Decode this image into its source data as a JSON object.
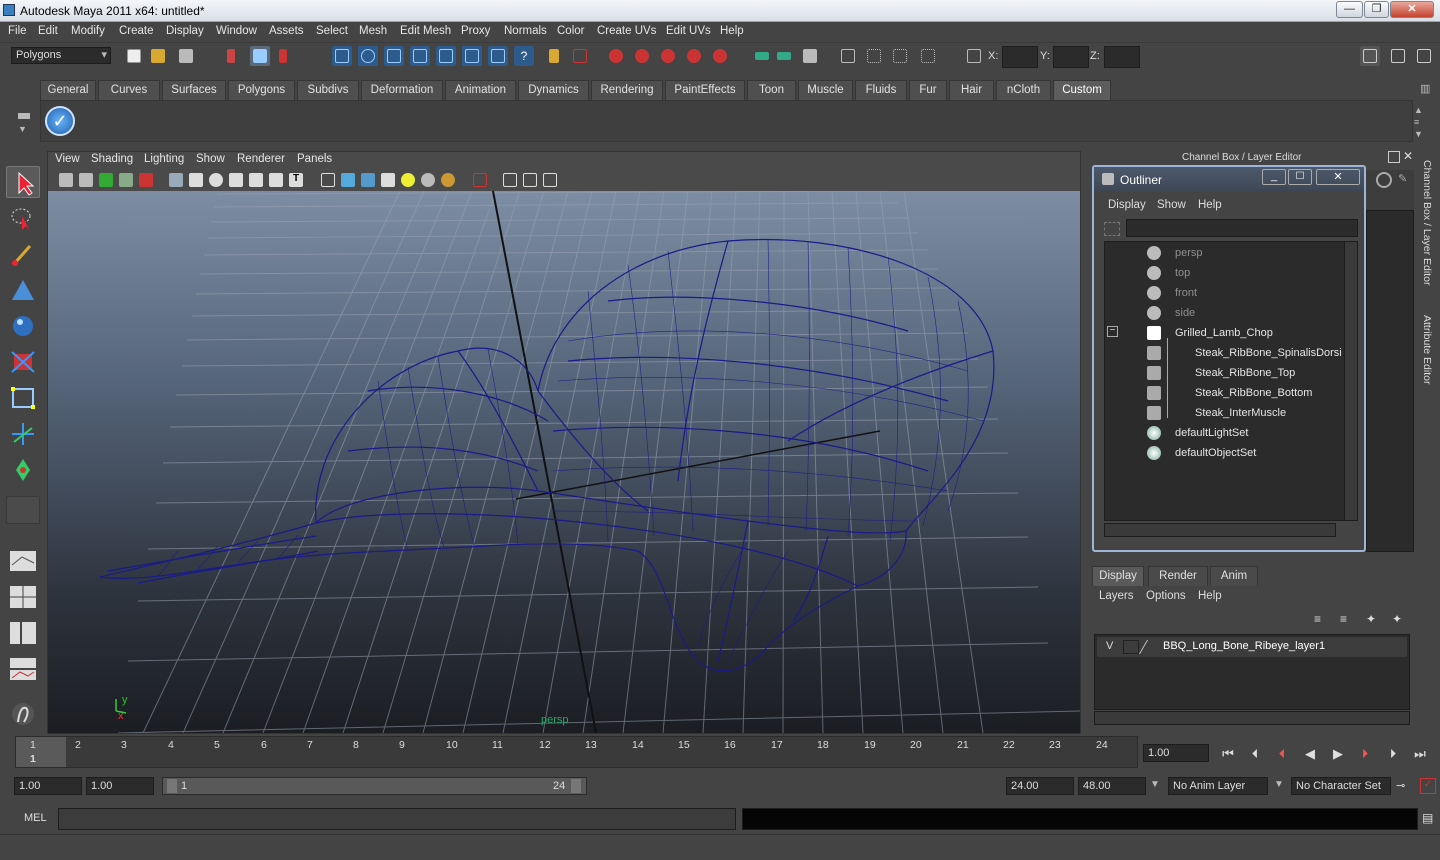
{
  "window": {
    "title": "Autodesk Maya 2011 x64: untitled*",
    "buttons": [
      "—",
      "❐",
      "✕"
    ]
  },
  "menubar": [
    "File",
    "Edit",
    "Modify",
    "Create",
    "Display",
    "Window",
    "Assets",
    "Select",
    "Mesh",
    "Edit Mesh",
    "Proxy",
    "Normals",
    "Color",
    "Create UVs",
    "Edit UVs",
    "Help"
  ],
  "status_line": {
    "mode": "Polygons",
    "x_label": "X:",
    "y_label": "Y:",
    "z_label": "Z:"
  },
  "shelf_tabs": [
    "General",
    "Curves",
    "Surfaces",
    "Polygons",
    "Subdivs",
    "Deformation",
    "Animation",
    "Dynamics",
    "Rendering",
    "PaintEffects",
    "Toon",
    "Muscle",
    "Fluids",
    "Fur",
    "Hair",
    "nCloth",
    "Custom"
  ],
  "active_shelf_tab": "Custom",
  "viewport": {
    "menu": [
      "View",
      "Shading",
      "Lighting",
      "Show",
      "Renderer",
      "Panels"
    ],
    "camera_label": "persp",
    "axis_y": "y",
    "axis_x": "x"
  },
  "right_panel": {
    "channel_box_title": "Channel Box / Layer Editor",
    "side_tabs": [
      "Channel Box / Layer Editor",
      "Attribute Editor"
    ]
  },
  "outliner": {
    "title": "Outliner",
    "menu": [
      "Display",
      "Show",
      "Help"
    ],
    "items": [
      {
        "label": "persp",
        "dim": true,
        "indent": 1
      },
      {
        "label": "top",
        "dim": true,
        "indent": 1
      },
      {
        "label": "front",
        "dim": true,
        "indent": 1
      },
      {
        "label": "side",
        "dim": true,
        "indent": 1
      },
      {
        "label": "Grilled_Lamb_Chop",
        "dim": false,
        "indent": 1
      },
      {
        "label": "Steak_RibBone_SpinalisDorsi",
        "dim": false,
        "indent": 2
      },
      {
        "label": "Steak_RibBone_Top",
        "dim": false,
        "indent": 2
      },
      {
        "label": "Steak_RibBone_Bottom",
        "dim": false,
        "indent": 2
      },
      {
        "label": "Steak_InterMuscle",
        "dim": false,
        "indent": 2
      },
      {
        "label": "defaultLightSet",
        "dim": false,
        "indent": 1
      },
      {
        "label": "defaultObjectSet",
        "dim": false,
        "indent": 1
      }
    ],
    "expand_symbol": "−"
  },
  "layer_editor": {
    "tabs": [
      "Display",
      "Render",
      "Anim"
    ],
    "menu": [
      "Layers",
      "Options",
      "Help"
    ],
    "layer": {
      "visible": "V",
      "name": "BBQ_Long_Bone_Ribeye_layer1"
    }
  },
  "timeline": {
    "ticks": [
      "1",
      "2",
      "3",
      "4",
      "5",
      "6",
      "7",
      "8",
      "9",
      "10",
      "11",
      "12",
      "13",
      "14",
      "15",
      "16",
      "17",
      "18",
      "19",
      "20",
      "21",
      "22",
      "23",
      "24"
    ],
    "current_frame": "1",
    "current_time_field": "1.00"
  },
  "range": {
    "start": "1.00",
    "start_inner": "1.00",
    "range_start_label": "1",
    "range_end_label": "24",
    "end_inner": "24.00",
    "end": "48.00",
    "anim_layer": "No Anim Layer",
    "character_set": "No Character Set"
  },
  "command_line": {
    "label": "MEL"
  },
  "colors": {
    "wireframe": "#1a1a8a",
    "viewport_top": "#7d8da3",
    "viewport_bottom": "#1b1d22"
  }
}
